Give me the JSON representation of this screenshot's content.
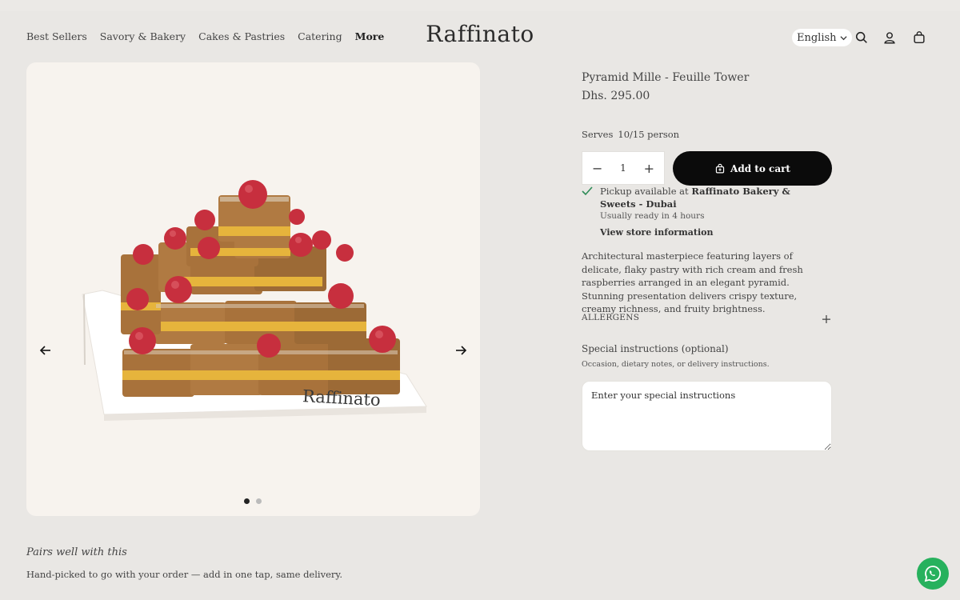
{
  "header": {
    "nav": [
      "Best Sellers",
      "Savory & Bakery",
      "Cakes & Pastries",
      "Catering",
      "More"
    ],
    "logo": "Raffinato",
    "language": "English"
  },
  "gallery": {
    "dots": 2,
    "active_dot": 1,
    "image_logo_text": "Raffinato"
  },
  "product": {
    "title": "Pyramid Mille - Feuille Tower",
    "price": "Dhs. 295.00",
    "serves_label": "Serves",
    "serves_value": "10/15 person",
    "quantity": "1",
    "add_to_cart": "Add to cart",
    "pickup_prefix": "Pickup available at ",
    "pickup_store": "Raffinato Bakery & Sweets - Dubai",
    "ready_text": "Usually ready in 4 hours",
    "store_info_link": "View store information",
    "description": "Architectural masterpiece featuring layers of delicate, flaky pastry with rich cream and fresh raspberries arranged in an elegant pyramid. Stunning presentation delivers crispy texture, creamy richness, and fruity brightness.",
    "allergens_label": "ALLERGENS",
    "special_title": "Special instructions (optional)",
    "special_hint": "Occasion, dietary notes, or delivery instructions.",
    "special_placeholder": "Enter your special instructions"
  },
  "pairs": {
    "title": "Pairs well with this",
    "subtitle": "Hand-picked to go with your order — add in one tap, same delivery."
  },
  "icons": [
    "search-icon",
    "account-icon",
    "cart-icon",
    "chevron-down-icon",
    "arrow-left-icon",
    "arrow-right-icon",
    "checkmark-icon",
    "bag-icon",
    "whatsapp-icon"
  ],
  "colors": {
    "background": "#e9e7e4",
    "button": "#0b0b0b",
    "check": "#2e8b57",
    "whatsapp": "#27b15d"
  }
}
